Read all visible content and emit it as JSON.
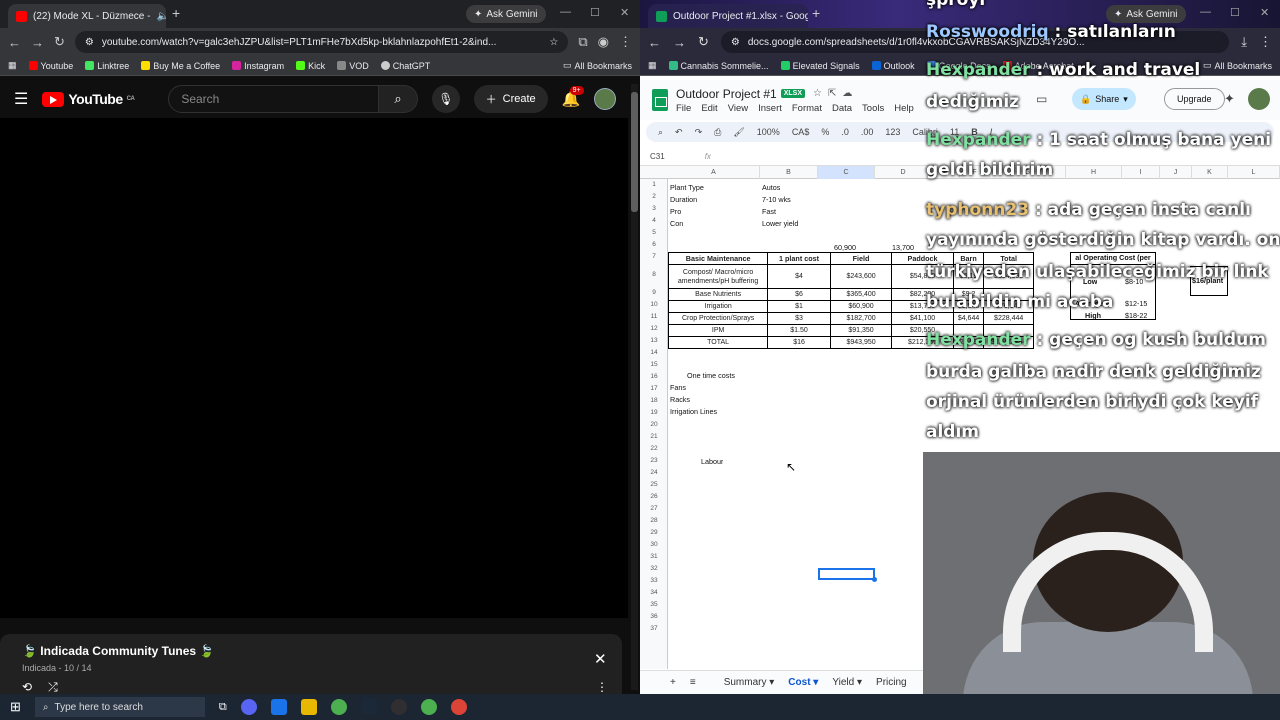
{
  "left_browser": {
    "tab_title": "(22) Mode XL - Düzmece - ",
    "ask_label": "Ask Gemini",
    "url": "youtube.com/watch?v=galc3ehJZPU&list=PLT1mFHe7bXd5kp-bklahnlazpohfEt1-2&ind...",
    "bookmarks": [
      "Youtube",
      "Linktree",
      "Buy Me a Coffee",
      "Instagram",
      "Kick",
      "VOD",
      "ChatGPT"
    ],
    "all_bookmarks": "All Bookmarks"
  },
  "youtube": {
    "logo_text": "YouTube",
    "logo_region": "CA",
    "search_placeholder": "Search",
    "create_label": "Create",
    "notif_count": "9+",
    "playlist": {
      "title": "🍃 Indicada Community Tunes 🍃",
      "subtitle": "Indicada - 10 / 14"
    }
  },
  "right_browser": {
    "tab_title": "Outdoor Project #1.xlsx - Goog",
    "ask_label": "Ask Gemini",
    "url": "docs.google.com/spreadsheets/d/1r0fl4vkxobCGAVRBSAKSjNZD34Y29O...",
    "bookmarks": [
      "Cannabis Sommelie...",
      "Elevated Signals",
      "Outlook",
      "Google Docs",
      "Adobe Acrobat"
    ],
    "all_bookmarks": "All Bookmarks"
  },
  "sheet": {
    "title": "Outdoor Project #1",
    "badge": "XLSX",
    "menus": [
      "File",
      "Edit",
      "View",
      "Insert",
      "Format",
      "Data",
      "Tools",
      "Help"
    ],
    "share_label": "Share",
    "upgrade_label": "Upgrade",
    "zoom": "100%",
    "currency": "CA$",
    "font": "Calibri",
    "font_size": "11",
    "cell_ref": "C31",
    "columns": [
      "A",
      "B",
      "C",
      "D",
      "E",
      "F",
      "G",
      "H",
      "I",
      "J",
      "K",
      "L"
    ],
    "info": [
      [
        "Plant Type",
        "Autos"
      ],
      [
        "Duration",
        "7-10 wks"
      ],
      [
        "Pro",
        "Fast"
      ],
      [
        "Con",
        "Lower yield"
      ]
    ],
    "row6": [
      "60,900",
      "13,700"
    ],
    "table_headers": [
      "Basic Maintenance",
      "1 plant cost",
      "Field",
      "Paddock",
      "Barn",
      "Total"
    ],
    "table_rows": [
      [
        "Compost/ Macro/micro amendments/pH buffering",
        "$4",
        "$243,600",
        "$54,800",
        "$6,19",
        "$304,592"
      ],
      [
        "Base Nutrients",
        "$6",
        "$365,400",
        "$82,200",
        "$9,2",
        ""
      ],
      [
        "Irrigation",
        "$1",
        "$60,900",
        "$13,700",
        "$1,548",
        "$76,148"
      ],
      [
        "Crop Protection/Sprays",
        "$3",
        "$182,700",
        "$41,100",
        "$4,644",
        "$228,444"
      ],
      [
        "IPM",
        "$1.50",
        "$91,350",
        "$20,550",
        "",
        ""
      ],
      [
        "TOTAL",
        "$16",
        "$943,950",
        "$212,350",
        "$23,994",
        "$1,180,294"
      ]
    ],
    "op_cost_title": "al Operating Cost (per",
    "op_cost_rows": [
      [
        "Low",
        "$8-10"
      ],
      [
        "Average",
        "$12-15"
      ],
      [
        "High",
        "$18-22"
      ]
    ],
    "per_plant": "$16/plant",
    "one_time_title": "One time costs",
    "one_time_items": [
      "Fans",
      "Racks",
      "Irrigation Lines"
    ],
    "labour": "Labour",
    "sheet_tabs": [
      "Summary",
      "Cost",
      "Yield",
      "Pricing"
    ]
  },
  "chat": [
    {
      "user": "",
      "msg": "şproyl"
    },
    {
      "user": "Rosswoodriq",
      "msg": ": satılanların"
    },
    {
      "user": "Hexpander",
      "msg": ": work and travel"
    },
    {
      "user": "",
      "msg": "dediğimiz"
    },
    {
      "user": "Hexpander",
      "msg": ": 1 saat olmuş bana yeni"
    },
    {
      "user": "",
      "msg": "geldi bildirim"
    },
    {
      "user": "typhonn23",
      "msg": ": ada geçen insta canlı"
    },
    {
      "user": "",
      "msg": "yayınında gösterdiğin kitap vardı. ona"
    },
    {
      "user": "",
      "msg": "türkiyeden ulaşabileceğimiz bir link"
    },
    {
      "user": "",
      "msg": "bulabildin mi acaba"
    },
    {
      "user": "Hexpander",
      "msg": ": geçen og kush buldum"
    },
    {
      "user": "",
      "msg": "burda galiba nadir denk geldiğimiz"
    },
    {
      "user": "",
      "msg": "orjinal ürünlerden biriydi çok keyif"
    },
    {
      "user": "",
      "msg": "aldım"
    }
  ],
  "taskbar": {
    "search_placeholder": "Type here to search"
  }
}
